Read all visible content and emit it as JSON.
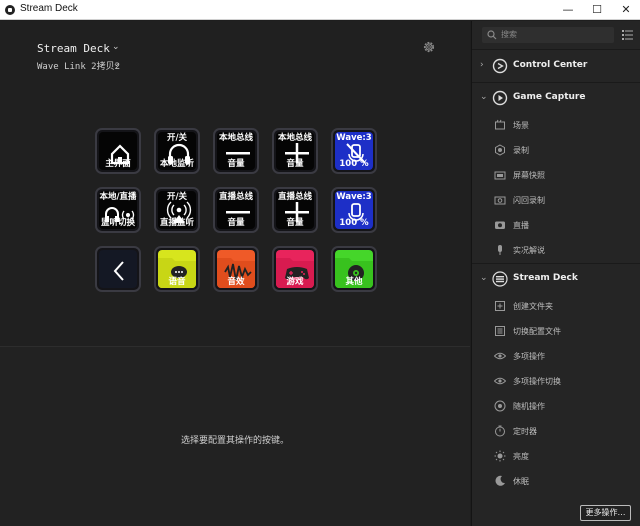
{
  "window": {
    "title": "Stream Deck",
    "minimize": "—",
    "maximize": "☐",
    "close": "✕"
  },
  "header": {
    "device_name": "Stream Deck",
    "profile_name": "Wave Link 2拷贝2"
  },
  "keys": [
    {
      "top": "",
      "bottom": "主界面",
      "icon": "home-icon",
      "bg": "#050505"
    },
    {
      "top": "开/关",
      "bottom": "本地监听",
      "icon": "headphones-icon",
      "bg": "#050505"
    },
    {
      "top": "本地总线",
      "bottom": "音量",
      "icon": "volume-down-icon",
      "bg": "#050505"
    },
    {
      "top": "本地总线",
      "bottom": "音量",
      "icon": "volume-up-icon",
      "bg": "#050505"
    },
    {
      "top": "Wave:3",
      "bottom": "100 %",
      "icon": "mic-muted-icon",
      "bg": "#1d2fc7"
    },
    {
      "top": "本地/直播",
      "bottom": "监听切换",
      "icon": "monitor-switch-icon",
      "bg": "#050505"
    },
    {
      "top": "开/关",
      "bottom": "直播监听",
      "icon": "broadcast-icon",
      "bg": "#050505"
    },
    {
      "top": "直播总线",
      "bottom": "音量",
      "icon": "volume-down-icon",
      "bg": "#050505"
    },
    {
      "top": "直播总线",
      "bottom": "音量",
      "icon": "volume-up-icon",
      "bg": "#050505"
    },
    {
      "top": "Wave:3",
      "bottom": "100 %",
      "icon": "mic-icon",
      "bg": "#1d2fc7"
    },
    {
      "top": "",
      "bottom": "",
      "icon": "back-icon",
      "bg": "#141824"
    },
    {
      "top": "",
      "bottom": "语音",
      "icon": "folder-chat-icon",
      "bg": "#d7e51d"
    },
    {
      "top": "",
      "bottom": "音效",
      "icon": "folder-wave-icon",
      "bg": "#ef5a28"
    },
    {
      "top": "",
      "bottom": "游戏",
      "icon": "folder-gamepad-icon",
      "bg": "#e8245c"
    },
    {
      "top": "",
      "bottom": "其他",
      "icon": "folder-disc-icon",
      "bg": "#45d62a"
    }
  ],
  "hint": "选择要配置其操作的按键。",
  "sidebar": {
    "search_placeholder": "搜索",
    "categories": [
      {
        "label": "Control Center",
        "expanded": false,
        "icon": "elgato-icon"
      },
      {
        "label": "Game Capture",
        "expanded": true,
        "icon": "play-circle-icon",
        "items": [
          "场景",
          "录制",
          "屏幕快照",
          "闪回录制",
          "直播",
          "实况解说"
        ]
      },
      {
        "label": "Stream Deck",
        "expanded": true,
        "icon": "streamdeck-grid-icon",
        "items": [
          "创建文件夹",
          "切换配置文件",
          "多项操作",
          "多项操作切换",
          "随机操作",
          "定时器",
          "亮度",
          "休眠"
        ]
      }
    ],
    "more_actions": "更多操作…"
  }
}
